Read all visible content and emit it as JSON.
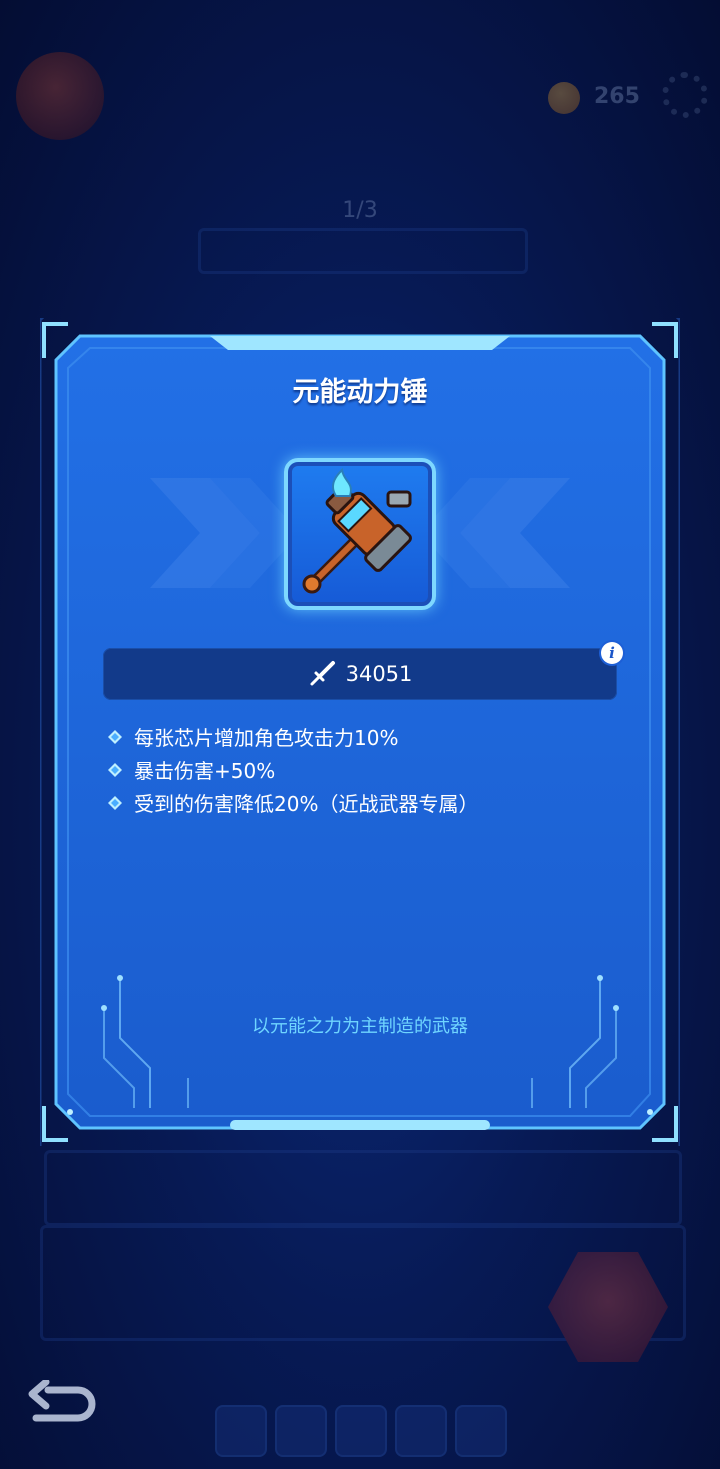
{
  "background": {
    "coin_count": "265",
    "pager": "1/3"
  },
  "dialog": {
    "title": "元能动力锤",
    "item_icon": "energy-hammer-icon",
    "power": {
      "icon": "sword-icon",
      "value": "34051"
    },
    "info_icon": "info-icon",
    "effects": [
      "每张芯片增加角色攻击力10%",
      "暴击伤害+50%",
      "受到的伤害降低20%（近战武器专属）"
    ],
    "flavor": "以元能之力为主制造的武器"
  },
  "colors": {
    "panel": "#1c66de",
    "panel_border": "#7fd8ff",
    "flavor_text": "#6fd5ff",
    "power_bar": "#123a8a"
  }
}
